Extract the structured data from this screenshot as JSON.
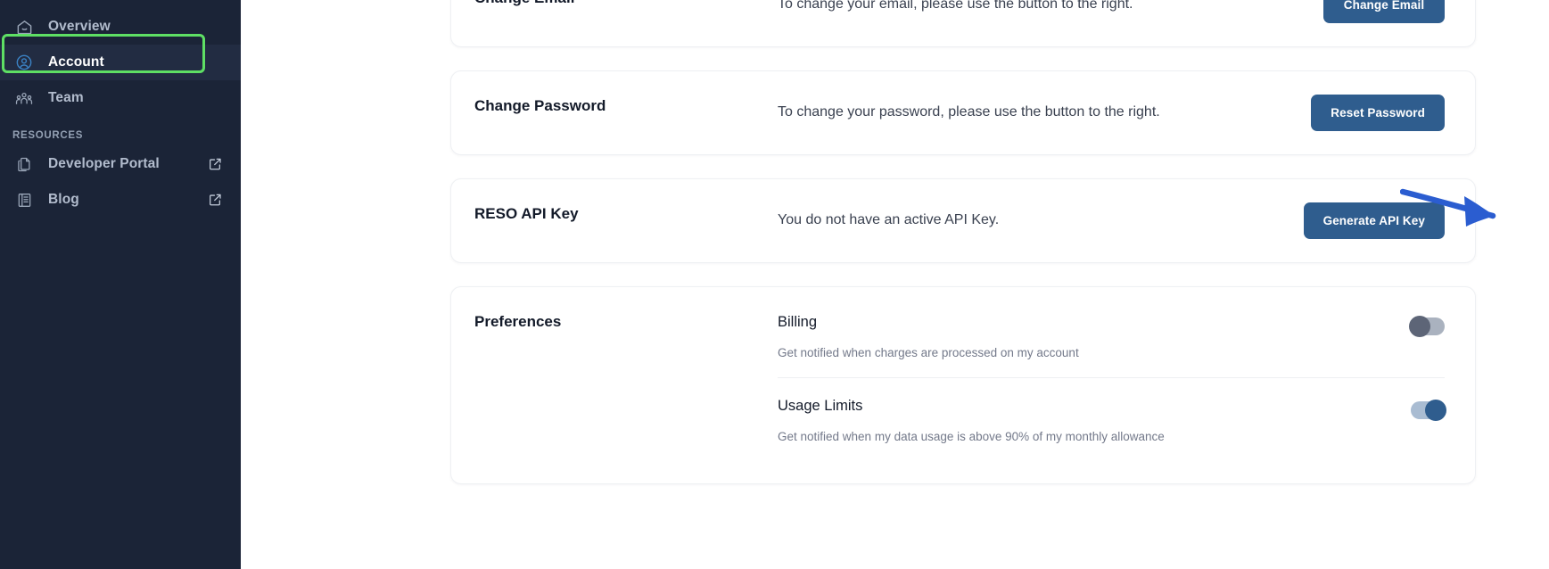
{
  "sidebar": {
    "items": [
      {
        "label": "Overview",
        "icon": "home-icon",
        "active": false,
        "external": false
      },
      {
        "label": "Account",
        "icon": "user-circle-icon",
        "active": true,
        "external": false
      },
      {
        "label": "Team",
        "icon": "team-icon",
        "active": false,
        "external": false
      }
    ],
    "section_label": "RESOURCES",
    "resources": [
      {
        "label": "Developer Portal",
        "icon": "documents-icon",
        "external": true
      },
      {
        "label": "Blog",
        "icon": "book-icon",
        "external": true
      }
    ],
    "background_color": "#1b2437",
    "highlight_color": "#5ee064",
    "active_icon_color": "#3b82c4"
  },
  "main": {
    "accent_color": "#2f5d8e",
    "cards": [
      {
        "title": "Change Email",
        "description": "To change your email, please use the button to the right.",
        "button": "Change Email"
      },
      {
        "title": "Change Password",
        "description": "To change your password, please use the button to the right.",
        "button": "Reset Password"
      },
      {
        "title": "RESO API Key",
        "description": "You do not have an active API Key.",
        "button": "Generate API Key"
      }
    ],
    "preferences": {
      "title": "Preferences",
      "rows": [
        {
          "name": "Billing",
          "sub": "Get notified when charges are processed on my account",
          "enabled": false
        },
        {
          "name": "Usage Limits",
          "sub": "Get notified when my data usage is above 90% of my monthly allowance",
          "enabled": true
        }
      ]
    }
  },
  "annotation": {
    "type": "arrow",
    "direction": "right",
    "color": "#2b5dd0"
  }
}
